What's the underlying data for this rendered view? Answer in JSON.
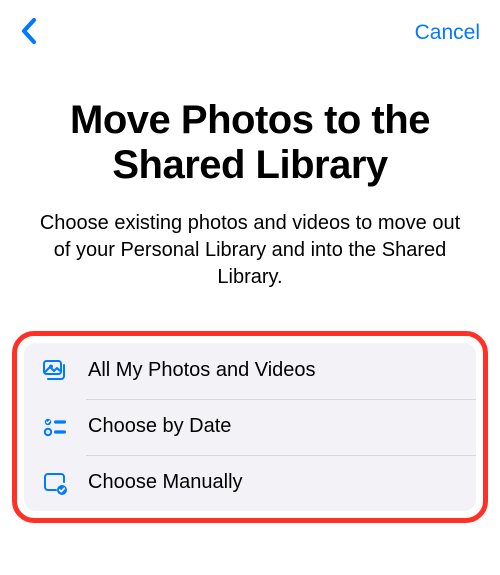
{
  "colors": {
    "accent": "#007aff",
    "highlight_border": "#ff3026",
    "list_bg": "#f2f2f7"
  },
  "nav": {
    "cancel_label": "Cancel"
  },
  "page": {
    "title": "Move Photos to the Shared Library",
    "description": "Choose existing photos and videos to move out of your Personal Library and into the Shared Library."
  },
  "options": [
    {
      "icon": "photos-stack-icon",
      "label": "All My Photos and Videos"
    },
    {
      "icon": "checklist-icon",
      "label": "Choose by Date"
    },
    {
      "icon": "rectangle-check-icon",
      "label": "Choose Manually"
    }
  ]
}
